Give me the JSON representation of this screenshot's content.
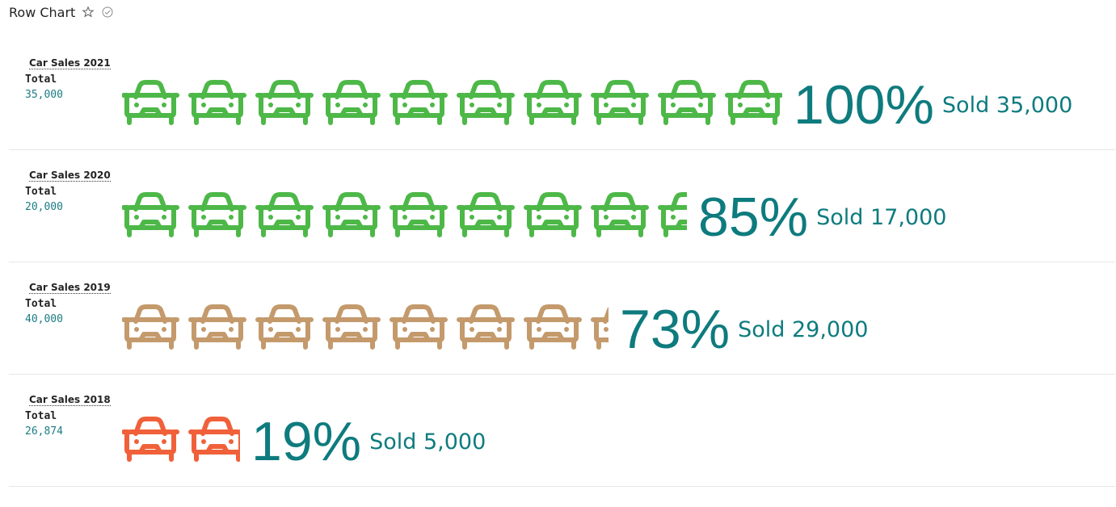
{
  "header": {
    "title": "Row Chart",
    "star_icon": "star-outline-icon",
    "check_icon": "check-circle-icon"
  },
  "chart_data": {
    "type": "bar",
    "subtype": "pictogram-row",
    "icon": "car-icon",
    "icons_per_row": 10,
    "rows": [
      {
        "label": "Car Sales 2021",
        "total_label": "Total",
        "total": "35,000",
        "percent": 100,
        "percent_text": "100%",
        "sold_text": "Sold 35,000",
        "color": "#4db848"
      },
      {
        "label": "Car Sales 2020",
        "total_label": "Total",
        "total": "20,000",
        "percent": 85,
        "percent_text": "85%",
        "sold_text": "Sold 17,000",
        "color": "#4db848"
      },
      {
        "label": "Car Sales 2019",
        "total_label": "Total",
        "total": "40,000",
        "percent": 73,
        "percent_text": "73%",
        "sold_text": "Sold 29,000",
        "color": "#c49a6c"
      },
      {
        "label": "Car Sales 2018",
        "total_label": "Total",
        "total": "26,874",
        "percent": 19,
        "percent_text": "19%",
        "sold_text": "Sold 5,000",
        "color": "#f0613a"
      }
    ]
  }
}
